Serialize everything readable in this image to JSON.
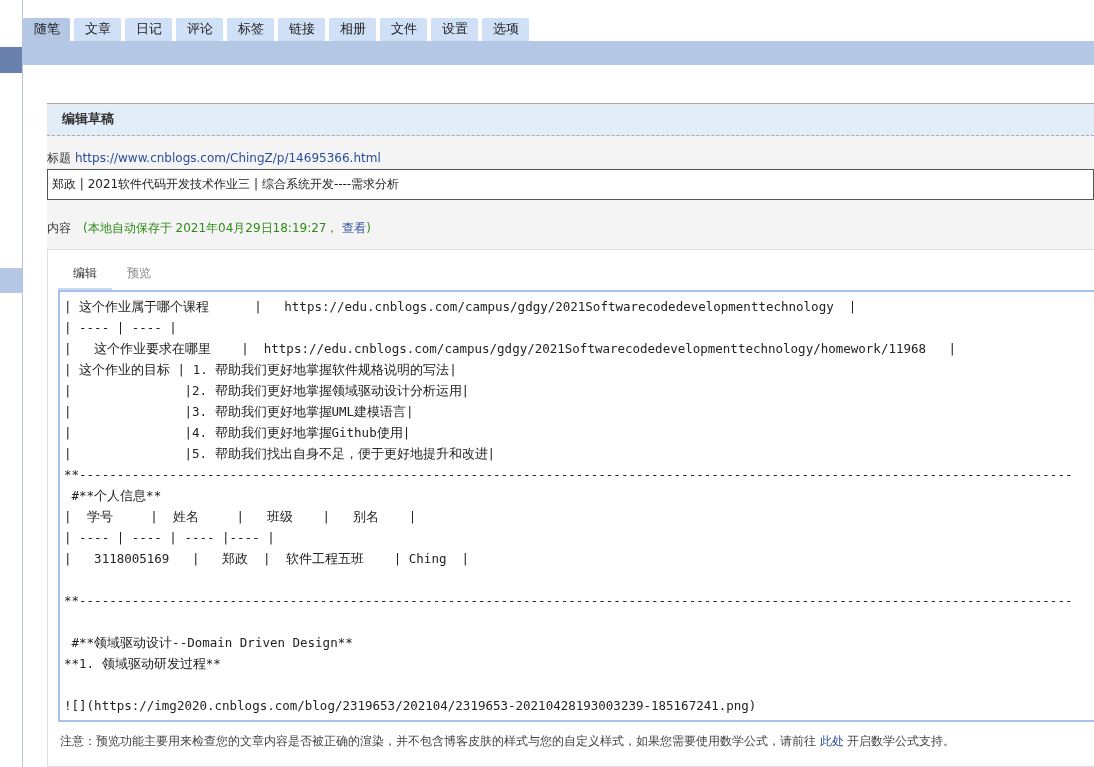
{
  "tabs": [
    {
      "label": "随笔",
      "selected": true
    },
    {
      "label": "文章",
      "selected": false
    },
    {
      "label": "日记",
      "selected": false
    },
    {
      "label": "评论",
      "selected": false
    },
    {
      "label": "标签",
      "selected": false
    },
    {
      "label": "链接",
      "selected": false
    },
    {
      "label": "相册",
      "selected": false
    },
    {
      "label": "文件",
      "selected": false
    },
    {
      "label": "设置",
      "selected": false
    },
    {
      "label": "选项",
      "selected": false
    }
  ],
  "section_title": "编辑草稿",
  "title_field": {
    "label": "标题",
    "url": "https://www.cnblogs.com/ChingZ/p/14695366.html",
    "value": "郑政 | 2021软件代码开发技术作业三 | 综合系统开发----需求分析"
  },
  "content_field": {
    "label": "内容",
    "autosave": "(本地自动保存于 2021年04月29日18:19:27，",
    "autosave_link": "查看",
    "autosave_end": ")"
  },
  "editor_tabs": [
    {
      "label": "编辑",
      "selected": true
    },
    {
      "label": "预览",
      "selected": false
    }
  ],
  "editor_lines": [
    "| 这个作业属于哪个课程      |   https://edu.cnblogs.com/campus/gdgy/2021Softwarecodedevelopmenttechnology  |",
    "| ---- | ---- |",
    "|   这个作业要求在哪里    |  https://edu.cnblogs.com/campus/gdgy/2021Softwarecodedevelopmenttechnology/homework/11968   |",
    "| 这个作业的目标 | 1. 帮助我们更好地掌握软件规格说明的写法|",
    "|               |2. 帮助我们更好地掌握领域驱动设计分析运用|",
    "|               |3. 帮助我们更好地掌握UML建模语言|",
    "|               |4. 帮助我们更好地掌握Github使用|",
    "|               |5. 帮助我们找出自身不足，便于更好地提升和改进|",
    "**------------------------------------------------------------------------------------------------------------------------------------",
    " #**个人信息**",
    "|  学号     |  姓名     |   班级    |   别名    |",
    "| ---- | ---- | ---- |---- |",
    "|   3118005169   |   郑政  |  软件工程五班    | Ching  |",
    {
      "kind": "blank"
    },
    "**------------------------------------------------------------------------------------------------------------------------------------",
    {
      "kind": "blank"
    },
    " #**领域驱动设计--Domain Driven Design**",
    "**1. 领域驱动研发过程**",
    {
      "kind": "blank"
    },
    "![](https://img2020.cnblogs.com/blog/2319653/202104/2319653-20210428193003239-185167241.png)"
  ],
  "note": {
    "before": "注意：预览功能主要用来检查您的文章内容是否被正确的渲染，并不包含博客皮肤的样式与您的自定义样式，如果您需要使用数学公式，请前往",
    "link": "此处",
    "after": "开启数学公式支持。"
  }
}
